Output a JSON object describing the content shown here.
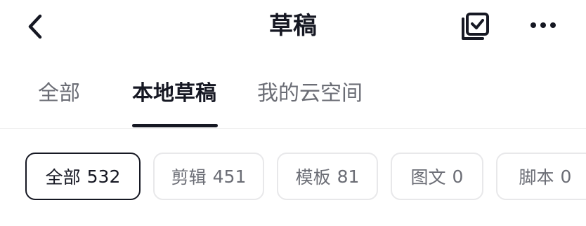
{
  "header": {
    "title": "草稿",
    "icons": {
      "back": "chevron-left-icon",
      "multiselect": "multiselect-check-icon",
      "more": "more-horizontal-icon"
    }
  },
  "tabs": [
    {
      "label": "全部",
      "active": false
    },
    {
      "label": "本地草稿",
      "active": true
    },
    {
      "label": "我的云空间",
      "active": false
    }
  ],
  "filters": [
    {
      "label": "全部",
      "count": "532",
      "active": true
    },
    {
      "label": "剪辑",
      "count": "451",
      "active": false
    },
    {
      "label": "模板",
      "count": "81",
      "active": false
    },
    {
      "label": "图文",
      "count": "0",
      "active": false
    },
    {
      "label": "脚本",
      "count": "0",
      "active": false
    }
  ],
  "colors": {
    "text_primary": "#161823",
    "text_secondary": "#6b6d75",
    "chip_border": "#e8e8ea",
    "background": "#ffffff"
  }
}
